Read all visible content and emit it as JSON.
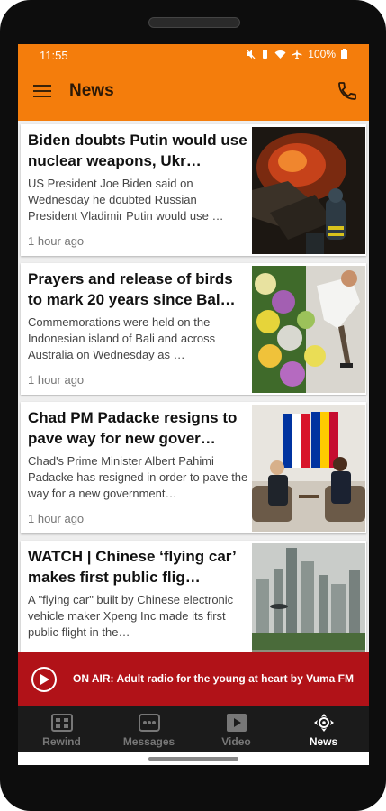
{
  "status_bar": {
    "time": "11:55",
    "battery": "100%"
  },
  "app_bar": {
    "title": "News"
  },
  "articles": [
    {
      "headline": "Biden doubts Putin would use nuclear weapons, Ukr…",
      "summary": "US President Joe Biden said on Wednesday he doubted Russian President Vladimir Putin would use …",
      "time": "1 hour ago"
    },
    {
      "headline": "Prayers and release of birds to mark 20 years since Bal…",
      "summary": "Commemorations were held on the Indonesian island of Bali and across Australia on Wednesday as …",
      "time": "1 hour ago"
    },
    {
      "headline": "Chad PM Padacke resigns to pave way for new gover…",
      "summary": "Chad's Prime Minister Albert Pahimi Padacke has resigned in order to pave the way for a new government…",
      "time": "1 hour ago"
    },
    {
      "headline": "WATCH | Chinese ‘flying car’ makes first public flig…",
      "summary": "A \"flying car\" built by Chinese electronic vehicle maker Xpeng Inc made its first public flight in the…",
      "time": ""
    }
  ],
  "radio": {
    "text": "ON AIR: Adult radio for the young at heart by Vuma FM"
  },
  "bottom_nav": [
    {
      "label": "Rewind",
      "icon": "rewind-icon",
      "active": false
    },
    {
      "label": "Messages",
      "icon": "messages-icon",
      "active": false
    },
    {
      "label": "Video",
      "icon": "video-icon",
      "active": false
    },
    {
      "label": "News",
      "icon": "news-icon",
      "active": true
    }
  ],
  "colors": {
    "accent": "#f47d0c",
    "radio_bar": "#b11218",
    "nav_bg": "#1b1b1b"
  }
}
